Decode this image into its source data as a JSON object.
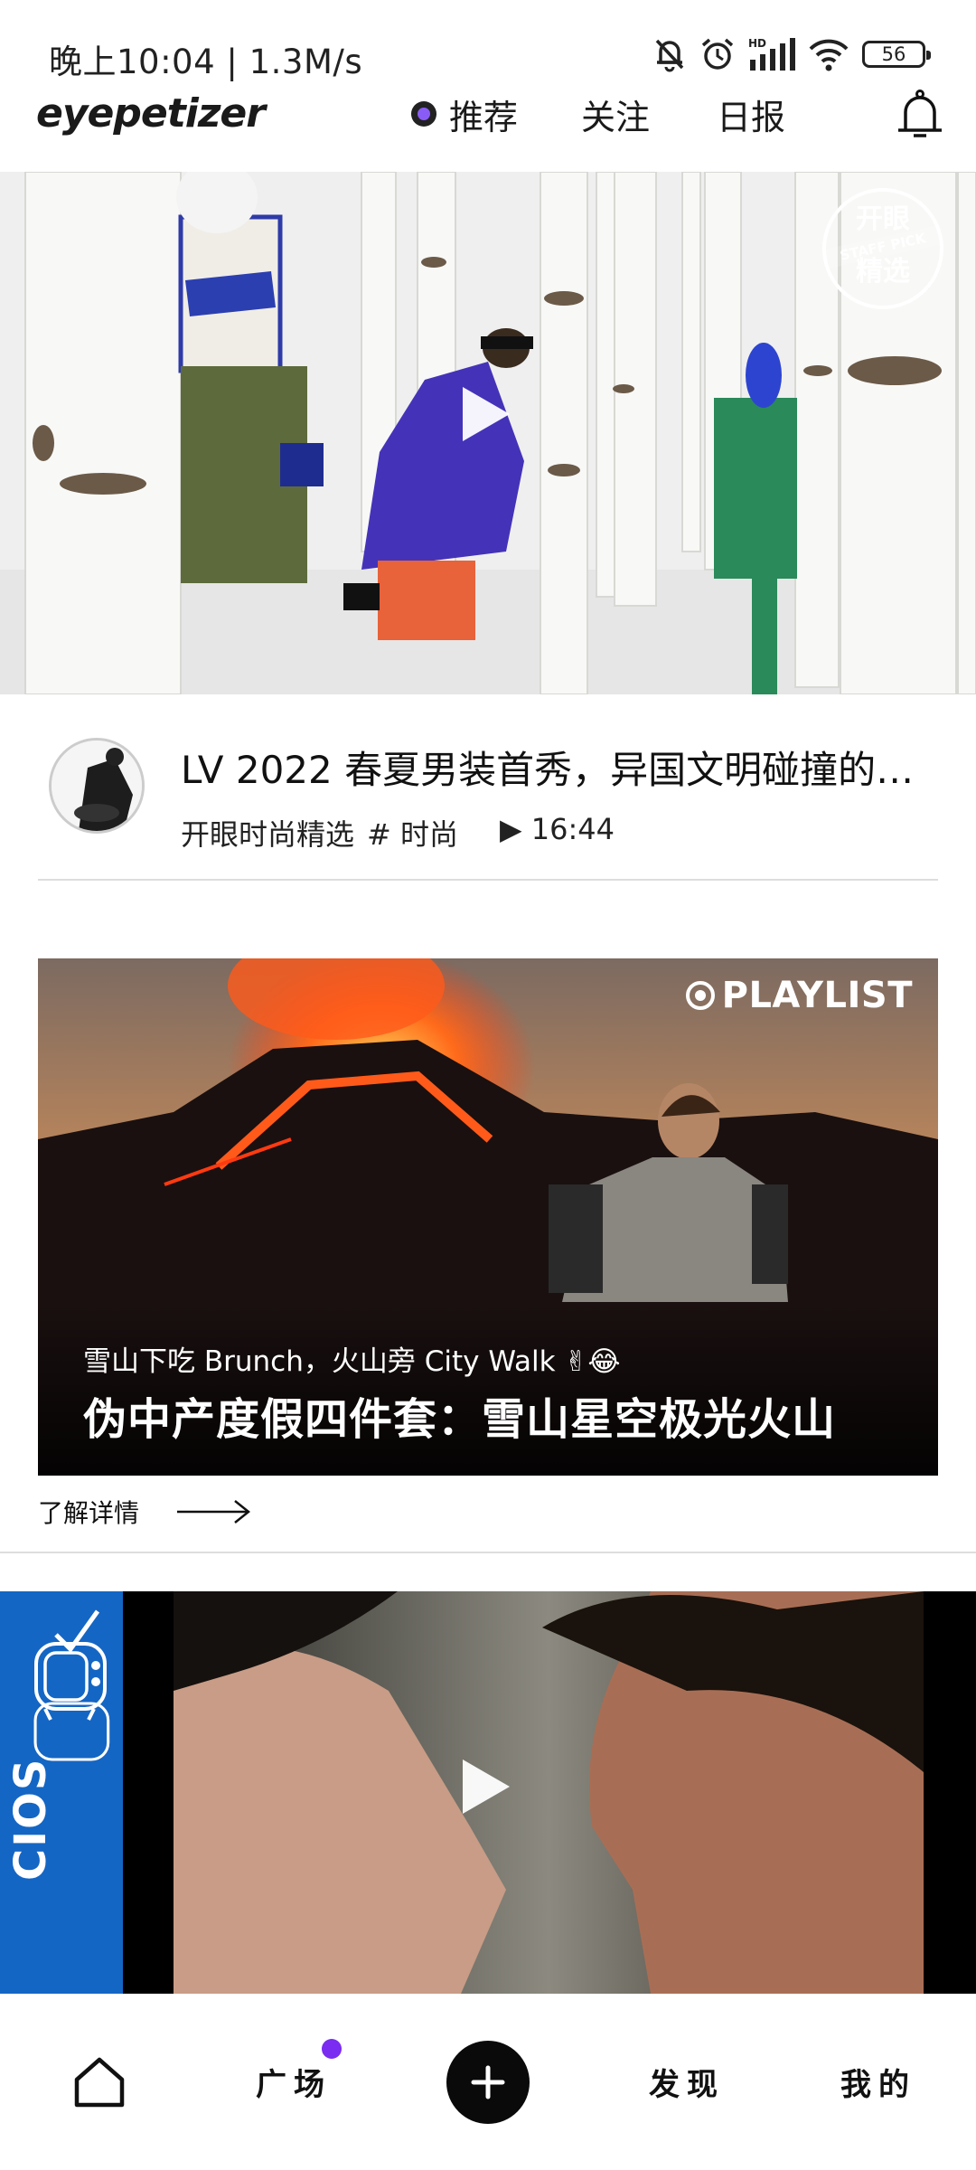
{
  "status_bar": {
    "time_speed": "晚上10:04 | 1.3M/s",
    "battery": "56",
    "icons": [
      "mute-bell-icon",
      "alarm-icon",
      "signal-icon",
      "wifi-icon",
      "battery-icon"
    ]
  },
  "header": {
    "logo": "eyepetizer",
    "tabs": [
      {
        "label": "推荐",
        "active": true
      },
      {
        "label": "关注",
        "active": false
      },
      {
        "label": "日报",
        "active": false
      }
    ],
    "bell_icon": "bell-icon"
  },
  "card1": {
    "badge_top": "开眼",
    "badge_mid": "STAFF PICK",
    "badge_bottom": "精选",
    "title": "LV 2022 春夏男装首秀，异国文明碰撞的…",
    "author": "开眼时尚精选",
    "tag": "# 时尚",
    "duration": "▶ 16:44"
  },
  "card2": {
    "badge": "PLAYLIST",
    "subtitle": "雪山下吃 Brunch，火山旁 City Walk ✌😂",
    "title": "伪中产度假四件套：雪山星空极光火山",
    "learn_more": "了解详情"
  },
  "card3": {
    "channel_text": "CIOS"
  },
  "bottom_nav": {
    "home_icon": "home-icon",
    "square": "广场",
    "plus_icon": "plus-icon",
    "discover": "发现",
    "mine": "我的",
    "notification_color": "#7a2cf0"
  }
}
